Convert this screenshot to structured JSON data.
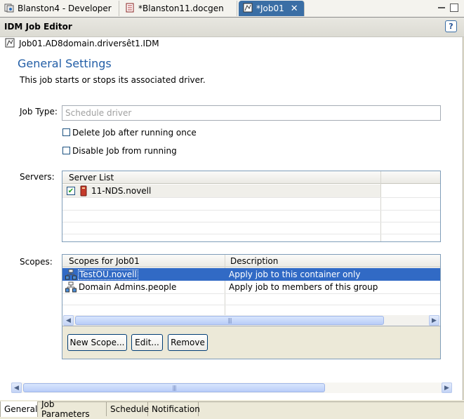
{
  "editor_tabs": [
    {
      "label": "Blanston4 - Developer"
    },
    {
      "label": "*Blanston11.docgen"
    },
    {
      "label": "*Job01",
      "active": true
    }
  ],
  "header": {
    "title": "IDM Job Editor",
    "help": "?"
  },
  "breadcrumb": "Job01.AD8domain.driversêt1.IDM",
  "section": {
    "title": "General Settings",
    "description": "This job starts or stops its associated driver."
  },
  "job_type": {
    "label": "Job Type:",
    "value": "Schedule driver"
  },
  "options": {
    "delete_after_run": {
      "label": "Delete Job after running once",
      "checked": false
    },
    "disable_job": {
      "label": "Disable Job from running",
      "checked": false
    }
  },
  "servers": {
    "label": "Servers:",
    "column_header": "Server List",
    "rows": [
      {
        "name": "11-NDS.novell",
        "checked": true
      }
    ]
  },
  "scopes": {
    "label": "Scopes:",
    "columns": [
      "Scopes for Job01",
      "Description"
    ],
    "rows": [
      {
        "scope": "TestOU.novell",
        "description": "Apply job to this container only",
        "selected": true
      },
      {
        "scope": "Domain Admins.people",
        "description": "Apply job to members of this group",
        "selected": false
      }
    ],
    "buttons": {
      "new": "New Scope...",
      "edit": "Edit...",
      "remove": "Remove"
    }
  },
  "bottom_tabs": [
    {
      "label": "General",
      "active": true
    },
    {
      "label": "Job Parameters"
    },
    {
      "label": "Schedule"
    },
    {
      "label": "Notification"
    }
  ],
  "colors": {
    "accent": "#3a6ea5",
    "selection": "#316ac5",
    "title": "#215da6"
  }
}
